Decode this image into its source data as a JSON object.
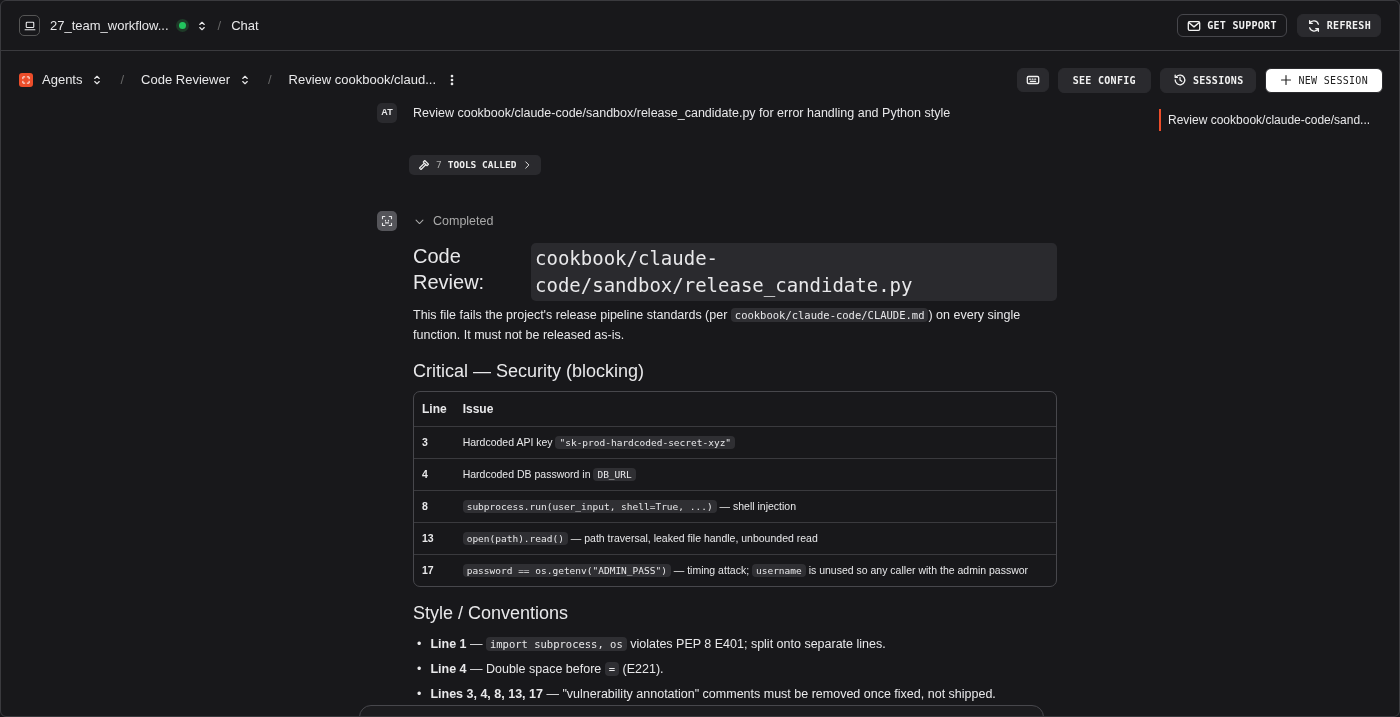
{
  "topbar": {
    "project": "27_team_workflow...",
    "online": true,
    "separator": "/",
    "section": "Chat",
    "buttons": [
      {
        "label": "GET SUPPORT",
        "kind": "outline"
      },
      {
        "label": "REFRESH",
        "kind": "filled"
      }
    ]
  },
  "breadcrumb": [
    {
      "label": "Agents",
      "dropdown": true,
      "logo": true
    },
    {
      "separator": "/",
      "label": "Code Reviewer",
      "dropdown": true,
      "logo": false
    },
    {
      "separator": "/",
      "label": "Review cookbook/claud...",
      "dropdown": false,
      "logo": false
    }
  ],
  "actions": [
    {
      "kind": "keyboard"
    },
    {
      "kind": "plain",
      "label": "SEE CONFIG"
    },
    {
      "kind": "history",
      "label": "SESSIONS"
    },
    {
      "kind": "primary",
      "label": "NEW SESSION"
    }
  ],
  "user_message": {
    "avatar": "AT",
    "text": "Review cookbook/claude-code/sandbox/release_candidate.py for error handling and Python style"
  },
  "tools": {
    "count": "7",
    "label": "TOOLS CALLED"
  },
  "response": {
    "status": "Completed",
    "expanded": true,
    "title": "Code Review:",
    "title_code": "cookbook/claude-code/sandbox/release_candidate.py",
    "intro": [
      {
        "kind": "text",
        "text": "This file fails the project's release pipeline standards (per "
      },
      {
        "kind": "code",
        "text": "cookbook/claude-code/CLAUDE.md"
      },
      {
        "kind": "text",
        "text": ") on every single function. It must not be released as-is."
      }
    ],
    "sections": [
      {
        "heading": "Critical — Security (blocking)",
        "kind": "table",
        "columns": [
          "Line",
          "Issue"
        ],
        "rows": [
          {
            "line": "3",
            "issue": [
              {
                "kind": "text",
                "text": "Hardcoded API key "
              },
              {
                "kind": "code",
                "text": "\"sk-prod-hardcoded-secret-xyz\""
              }
            ]
          },
          {
            "line": "4",
            "issue": [
              {
                "kind": "text",
                "text": "Hardcoded DB password in "
              },
              {
                "kind": "code",
                "text": "DB_URL"
              }
            ]
          },
          {
            "line": "8",
            "issue": [
              {
                "kind": "code",
                "text": "subprocess.run(user_input, shell=True, ...)"
              },
              {
                "kind": "text",
                "text": " — shell injection"
              }
            ]
          },
          {
            "line": "13",
            "issue": [
              {
                "kind": "code",
                "text": "open(path).read()"
              },
              {
                "kind": "text",
                "text": " — path traversal, leaked file handle, unbounded read"
              }
            ]
          },
          {
            "line": "17",
            "issue": [
              {
                "kind": "code",
                "text": "password == os.getenv(\"ADMIN_PASS\")"
              },
              {
                "kind": "text",
                "text": " — timing attack; "
              },
              {
                "kind": "code",
                "text": "username"
              },
              {
                "kind": "text",
                "text": " is unused so any caller with the admin passwor"
              }
            ]
          }
        ]
      },
      {
        "heading": "Style / Conventions",
        "kind": "list",
        "items": [
          {
            "bullet": "•",
            "parts": [
              {
                "kind": "bold",
                "text": "Line 1"
              },
              {
                "kind": "text",
                "text": " — "
              },
              {
                "kind": "code",
                "text": "import subprocess, os"
              },
              {
                "kind": "text",
                "text": " violates PEP 8 E401; split onto separate lines."
              }
            ]
          },
          {
            "bullet": "•",
            "parts": [
              {
                "kind": "bold",
                "text": "Line 4"
              },
              {
                "kind": "text",
                "text": " — Double space before "
              },
              {
                "kind": "code",
                "text": "="
              },
              {
                "kind": "text",
                "text": " (E221)."
              }
            ]
          },
          {
            "bullet": "•",
            "parts": [
              {
                "kind": "bold",
                "text": "Lines 3, 4, 8, 13, 17"
              },
              {
                "kind": "text",
                "text": " — \"vulnerability annotation\" comments must be removed once fixed, not shipped."
              }
            ]
          }
        ]
      }
    ]
  },
  "outline": [
    {
      "label": "Review cookbook/claude-code/sand...",
      "selected": true
    }
  ]
}
